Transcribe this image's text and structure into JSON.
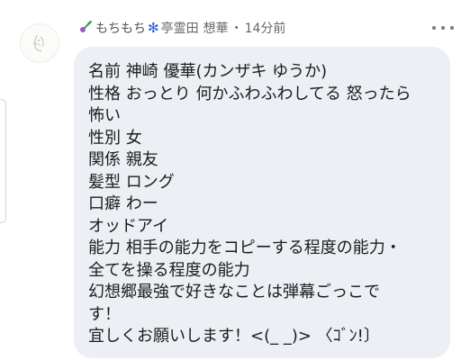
{
  "post": {
    "author_name": "もちもち",
    "group": "亭霊田",
    "member": "想華",
    "time": "14分前",
    "snowflake": "✻",
    "separator": "・",
    "lines": [
      "名前 神崎 優華(カンザキ ゆうか)",
      "性格 おっとり 何かふわふわしてる 怒ったら",
      "怖い",
      "性別 女",
      "関係 親友",
      "髪型 ロング",
      "口癖 わー",
      "オッドアイ",
      "能力 相手の能力をコピーする程度の能力・",
      "全てを操る程度の能力",
      "幻想郷最強で好きなことは弾幕ごっこで",
      "す！",
      "宜しくお願いします！<(_ _)> 〈ｺﾞﾝ!〕"
    ]
  },
  "icons": {
    "badge": "leaf-badge-icon",
    "more": "more-options-icon",
    "snow": "snowflake-icon"
  },
  "colors": {
    "bubble": "#eceff3",
    "meta_text": "#666666",
    "snowflake": "#2a5fd0",
    "badge_green": "#3aa35a",
    "badge_purple": "#a455c6"
  }
}
